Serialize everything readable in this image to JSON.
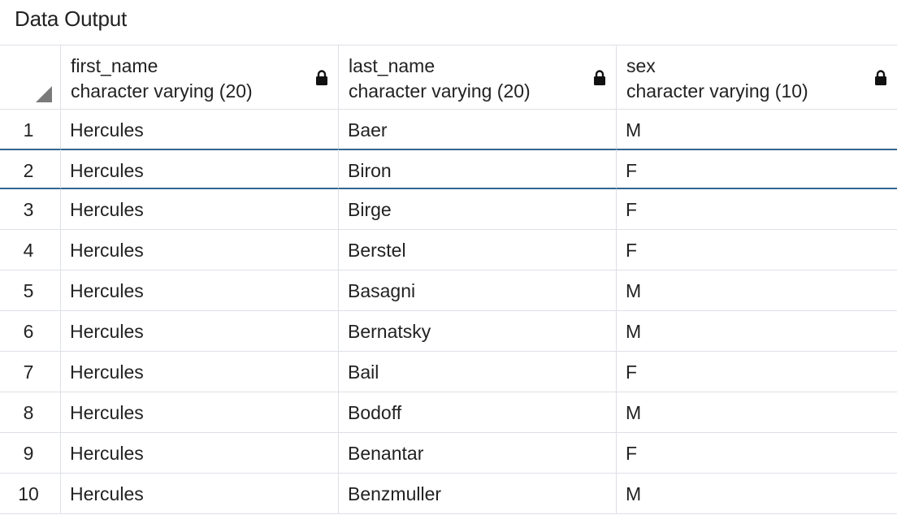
{
  "panel": {
    "title": "Data Output"
  },
  "columns": [
    {
      "name": "first_name",
      "type": "character varying (20)"
    },
    {
      "name": "last_name",
      "type": "character varying (20)"
    },
    {
      "name": "sex",
      "type": "character varying (10)"
    }
  ],
  "rows": [
    {
      "num": "1",
      "first_name": "Hercules",
      "last_name": "Baer",
      "sex": "M"
    },
    {
      "num": "2",
      "first_name": "Hercules",
      "last_name": "Biron",
      "sex": "F"
    },
    {
      "num": "3",
      "first_name": "Hercules",
      "last_name": "Birge",
      "sex": "F"
    },
    {
      "num": "4",
      "first_name": "Hercules",
      "last_name": "Berstel",
      "sex": "F"
    },
    {
      "num": "5",
      "first_name": "Hercules",
      "last_name": "Basagni",
      "sex": "M"
    },
    {
      "num": "6",
      "first_name": "Hercules",
      "last_name": "Bernatsky",
      "sex": "M"
    },
    {
      "num": "7",
      "first_name": "Hercules",
      "last_name": "Bail",
      "sex": "F"
    },
    {
      "num": "8",
      "first_name": "Hercules",
      "last_name": "Bodoff",
      "sex": "M"
    },
    {
      "num": "9",
      "first_name": "Hercules",
      "last_name": "Benantar",
      "sex": "F"
    },
    {
      "num": "10",
      "first_name": "Hercules",
      "last_name": "Benzmuller",
      "sex": "M"
    }
  ],
  "selected_row": "2",
  "colors": {
    "selection_border": "#326690",
    "grid_line": "#dde0e6",
    "corner_triangle": "#7a7a7a"
  },
  "icons": {
    "column_lock": "lock-icon",
    "corner": "select-all-triangle-icon"
  }
}
